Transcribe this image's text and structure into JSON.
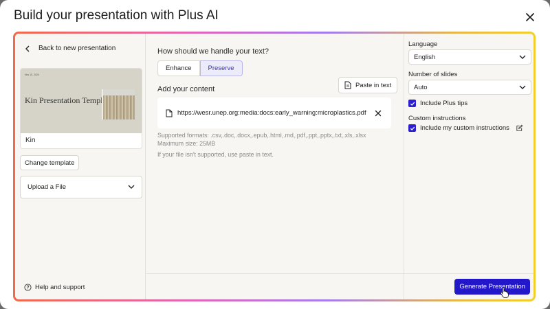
{
  "modal": {
    "title": "Build your presentation with Plus AI"
  },
  "left": {
    "back_label": "Back to new presentation",
    "template": {
      "thumb_date": "Nov 10, 2024",
      "thumb_title": "Kin Presentation Template",
      "name": "Kin"
    },
    "change_template_label": "Change template",
    "upload_select_value": "Upload a File",
    "help_label": "Help and support"
  },
  "middle": {
    "question": "How should we handle your text?",
    "modes": [
      {
        "label": "Enhance",
        "active": false
      },
      {
        "label": "Preserve",
        "active": true
      }
    ],
    "add_content_label": "Add your content",
    "paste_label": "Paste in text",
    "file_url": "https://wesr.unep.org:media:docs:early_warning:microplastics.pdf",
    "supported_formats": "Supported formats: .csv,.doc,.docx,.epub,.html,.md,.pdf,.ppt,.pptx,.txt,.xls,.xlsx",
    "max_size": "Maximum size: 25MB",
    "fallback_hint": "If your file isn't supported, use paste in text."
  },
  "right": {
    "language_label": "Language",
    "language_value": "English",
    "slides_label": "Number of slides",
    "slides_value": "Auto",
    "tips_label": "Include Plus tips",
    "custom_label": "Custom instructions",
    "custom_check_label": "Include my custom instructions"
  },
  "footer": {
    "generate_label": "Generate Presentation"
  },
  "colors": {
    "accent": "#2218c9",
    "active_seg_bg": "#ecebfa",
    "panel_bg": "#f7f6f3"
  }
}
